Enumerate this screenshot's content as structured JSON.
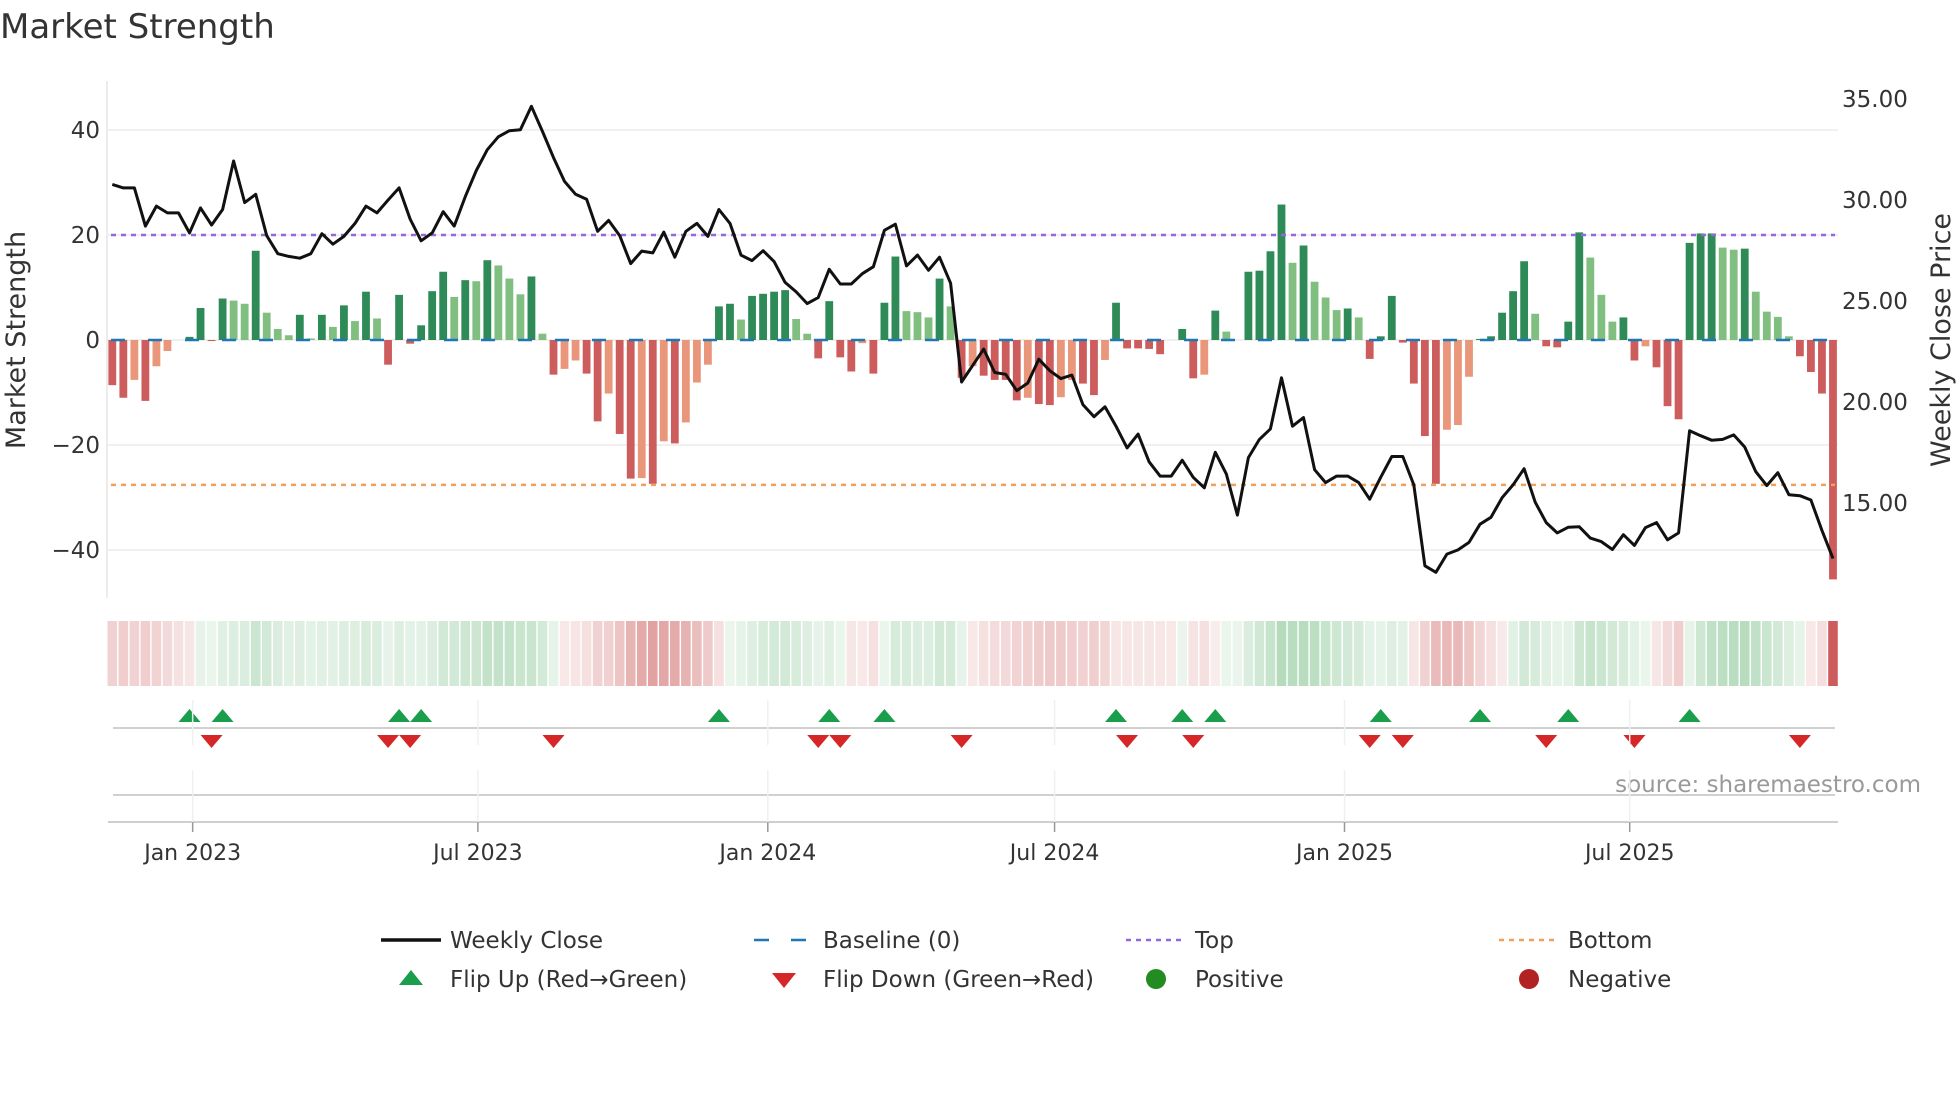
{
  "chart_data": {
    "type": "bar",
    "title": "Market Strength",
    "ylabel": "Market Strength",
    "y2label": "Weekly Close Price",
    "source": "source: sharemaestro.com",
    "start_date": "2022-11-11",
    "frequency": "weekly",
    "ylim": [
      -48,
      50
    ],
    "y2lim": [
      10.4,
      36
    ],
    "yticks": [
      40,
      20,
      0,
      -20,
      -40
    ],
    "ytick_labels": [
      "40",
      "20",
      "0",
      "−20",
      "−40"
    ],
    "y2ticks": [
      35,
      30,
      25,
      20,
      15
    ],
    "y2tick_labels": [
      "35.00",
      "30.00",
      "25.00",
      "20.00",
      "15.00"
    ],
    "xticks": [
      {
        "date": "2023-01-01",
        "label": "Jan 2023"
      },
      {
        "date": "2023-07-01",
        "label": "Jul 2023"
      },
      {
        "date": "2024-01-01",
        "label": "Jan 2024"
      },
      {
        "date": "2024-07-01",
        "label": "Jul 2024"
      },
      {
        "date": "2025-01-01",
        "label": "Jan 2025"
      },
      {
        "date": "2025-07-01",
        "label": "Jul 2025"
      }
    ],
    "top": 20,
    "bottom": -27.6,
    "grid": true,
    "legend_placement": "bottom",
    "strength": [
      -8.6,
      -11,
      -7.6,
      -11.6,
      -5,
      -2.1,
      0,
      0.6,
      6.1,
      -0.2,
      7.9,
      7.5,
      6.9,
      17,
      5.2,
      2.1,
      0.9,
      4.8,
      0.3,
      4.8,
      2.5,
      6.6,
      3.6,
      9.2,
      4.1,
      -4.7,
      8.6,
      -0.7,
      2.8,
      9.3,
      13,
      8.2,
      11.4,
      11.2,
      15.2,
      14.2,
      11.7,
      8.7,
      12.1,
      1.2,
      -6.6,
      -5.5,
      -3.9,
      -6.4,
      -15.5,
      -10.2,
      -17.9,
      -26.4,
      -26.3,
      -27.4,
      -19.3,
      -19.7,
      -15.7,
      -8.1,
      -4.7,
      6.4,
      6.9,
      3.9,
      8.4,
      8.8,
      9.2,
      9.5,
      4.0,
      1.2,
      -3.5,
      7.4,
      -3.3,
      -6.0,
      -0.6,
      -6.4,
      7.1,
      15.9,
      5.5,
      5.3,
      4.3,
      11.7,
      6.4,
      -7.2,
      -5,
      -6.8,
      -7.6,
      -7.6,
      -11.5,
      -11,
      -12.2,
      -12.4,
      -10.9,
      -7.6,
      -8.3,
      -10.5,
      -3.8,
      7.1,
      -1.6,
      -1.6,
      -1.7,
      -2.7,
      0,
      2.1,
      -7.3,
      -6.6,
      5.6,
      1.6,
      0,
      13,
      13.2,
      16.9,
      25.8,
      14.7,
      18,
      11.1,
      8.1,
      5.7,
      6.0,
      4.3,
      -3.6,
      0.7,
      8.4,
      -0.5,
      -8.3,
      -18.3,
      -27.4,
      -17.1,
      -16.2,
      -7,
      0.2,
      0.7,
      5.2,
      9.3,
      15,
      5.0,
      -1.2,
      -1.4,
      3.5,
      20.5,
      15.7,
      8.6,
      3.5,
      4.3,
      -3.9,
      -1.2,
      -5.2,
      -12.6,
      -15.1,
      18.5,
      20.3,
      20.3,
      17.6,
      17.2,
      17.4,
      9.2,
      5.4,
      4.4,
      0.7,
      -3.1,
      -6.1,
      -10.2,
      -45.6
    ],
    "weekly_close": [
      30.77,
      30.6,
      30.6,
      28.71,
      29.7,
      29.36,
      29.36,
      28.37,
      29.61,
      28.76,
      29.53,
      31.93,
      29.87,
      30.28,
      28.24,
      27.34,
      27.21,
      27.12,
      27.34,
      28.33,
      27.81,
      28.2,
      28.84,
      29.7,
      29.36,
      30,
      30.6,
      29.06,
      27.98,
      28.37,
      29.42,
      28.71,
      30.17,
      31.46,
      32.49,
      33.13,
      33.43,
      33.48,
      34.64,
      33.39,
      32.1,
      30.92,
      30.28,
      30.04,
      28.45,
      28.99,
      28.24,
      26.85,
      27.47,
      27.38,
      28.41,
      27.17,
      28.45,
      28.84,
      28.2,
      29.53,
      28.84,
      27.27,
      27,
      27.49,
      26.95,
      25.92,
      25.45,
      24.87,
      25.17,
      26.57,
      25.84,
      25.84,
      26.35,
      26.7,
      28.5,
      28.8,
      26.74,
      27.27,
      26.52,
      27.17,
      25.88,
      20.99,
      21.8,
      22.62,
      21.46,
      21.37,
      20.56,
      20.94,
      22.12,
      21.55,
      21.16,
      21.33,
      19.87,
      19.27,
      19.76,
      18.8,
      17.73,
      18.41,
      17.04,
      16.33,
      16.33,
      17.12,
      16.27,
      15.75,
      17.51,
      16.44,
      14.4,
      17.25,
      18.15,
      18.67,
      21.2,
      18.8,
      19.23,
      16.65,
      16.01,
      16.33,
      16.33,
      16.01,
      15.19,
      16.27,
      17.3,
      17.3,
      15.9,
      11.89,
      11.57,
      12.47,
      12.68,
      13.05,
      13.95,
      14.29,
      15.26,
      15.9,
      16.7,
      15.04,
      14.03,
      13.52,
      13.8,
      13.82,
      13.26,
      13.09,
      12.7,
      13.43,
      12.9,
      13.78,
      14.03,
      13.18,
      13.52,
      18.58,
      18.33,
      18.11,
      18.15,
      18.37,
      17.77,
      16.55,
      15.86,
      16.5,
      15.41,
      15.36,
      15.15,
      13.65,
      12.25
    ],
    "flip_up_weeks": [
      8,
      11,
      27,
      29,
      56,
      66,
      71,
      92,
      98,
      101,
      116,
      125,
      133,
      144
    ],
    "flip_down_weeks": [
      10,
      26,
      28,
      41,
      65,
      67,
      78,
      93,
      99,
      115,
      118,
      131,
      139,
      154
    ],
    "legend": [
      {
        "key": "close",
        "label": "Weekly Close"
      },
      {
        "key": "baseline",
        "label": "Baseline (0)"
      },
      {
        "key": "top",
        "label": "Top"
      },
      {
        "key": "bottom",
        "label": "Bottom"
      },
      {
        "key": "flip_up",
        "label": "Flip Up (Red→Green)"
      },
      {
        "key": "flip_down",
        "label": "Flip Down (Green→Red)"
      },
      {
        "key": "positive",
        "label": "Positive"
      },
      {
        "key": "negative",
        "label": "Negative"
      }
    ]
  },
  "colors": {
    "pos_rising": "#2e8b57",
    "pos_falling": "#80bf7f",
    "neg_falling": "#cd5c5c",
    "neg_rising": "#e9967a",
    "close": "#111111",
    "baseline": "#1f77b4",
    "top": "#9467dd",
    "bottom": "#f0a05a",
    "flip_up": "#1a9e4b",
    "flip_down": "#d62728",
    "positive": "#228b22",
    "negative": "#b22222"
  }
}
